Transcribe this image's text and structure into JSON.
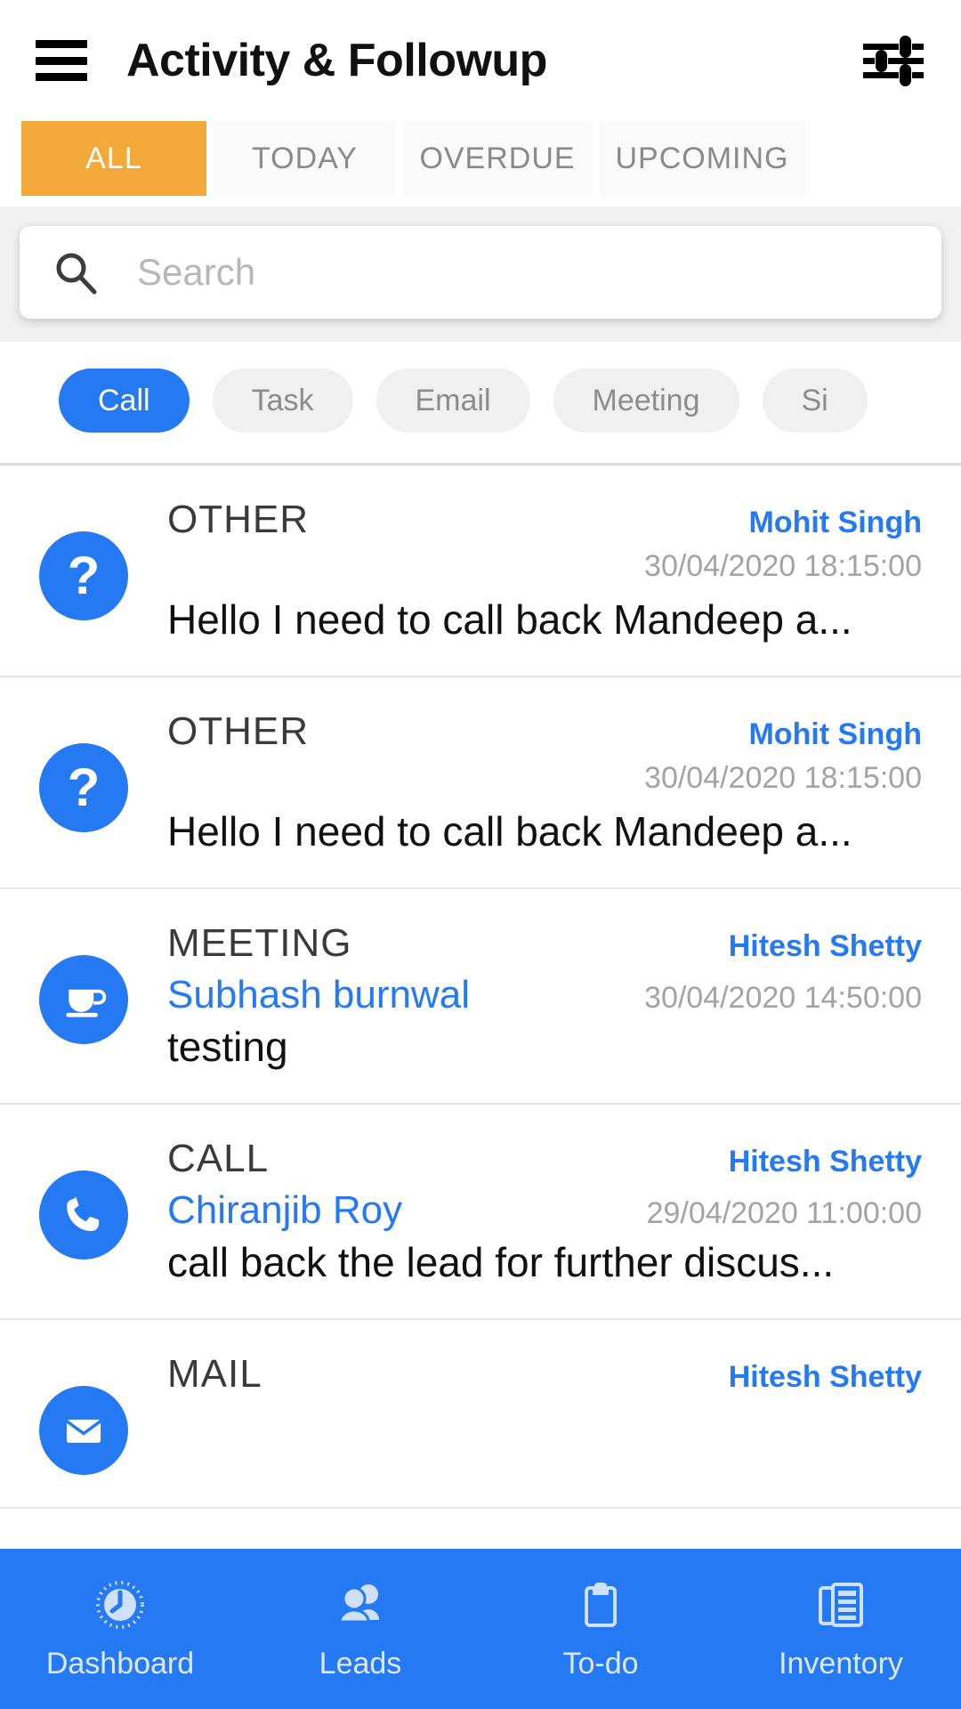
{
  "appbar": {
    "title": "Activity & Followup",
    "menu_icon": "hamburger-menu-icon",
    "filter_icon": "filter-sliders-icon"
  },
  "tabs": [
    {
      "label": "ALL",
      "active": true
    },
    {
      "label": "TODAY",
      "active": false
    },
    {
      "label": "OVERDUE",
      "active": false
    },
    {
      "label": "UPCOMING",
      "active": false
    }
  ],
  "search": {
    "placeholder": "Search",
    "value": "",
    "icon": "search-icon"
  },
  "chips": [
    {
      "label": "Call",
      "active": true
    },
    {
      "label": "Task",
      "active": false
    },
    {
      "label": "Email",
      "active": false
    },
    {
      "label": "Meeting",
      "active": false
    },
    {
      "label": "Si",
      "active": false
    }
  ],
  "list": [
    {
      "type": "OTHER",
      "icon": "question-mark-icon",
      "owner": "Mohit Singh",
      "contact": "",
      "date": "30/04/2020 18:15:00",
      "description": "Hello I need to call back Mandeep a..."
    },
    {
      "type": "OTHER",
      "icon": "question-mark-icon",
      "owner": "Mohit Singh",
      "contact": "",
      "date": "30/04/2020 18:15:00",
      "description": "Hello I need to call back Mandeep a..."
    },
    {
      "type": "MEETING",
      "icon": "coffee-cup-icon",
      "owner": "Hitesh Shetty",
      "contact": "Subhash burnwal",
      "date": "30/04/2020 14:50:00",
      "description": "testing"
    },
    {
      "type": "CALL",
      "icon": "phone-icon",
      "owner": "Hitesh Shetty",
      "contact": "Chiranjib Roy",
      "date": "29/04/2020 11:00:00",
      "description": "call back the lead for further discus..."
    },
    {
      "type": "MAIL",
      "icon": "mail-icon",
      "owner": "Hitesh Shetty",
      "contact": "",
      "date": "",
      "description": ""
    }
  ],
  "bottom_nav": [
    {
      "label": "Dashboard",
      "icon": "dashboard-gauge-icon"
    },
    {
      "label": "Leads",
      "icon": "people-icon"
    },
    {
      "label": "To-do",
      "icon": "clipboard-icon"
    },
    {
      "label": "Inventory",
      "icon": "newspaper-icon"
    }
  ],
  "colors": {
    "accent_blue": "#2579f2",
    "tab_active_orange": "#f3a83a",
    "link_blue": "#2579f2",
    "muted_gray": "#a3a3a3"
  }
}
